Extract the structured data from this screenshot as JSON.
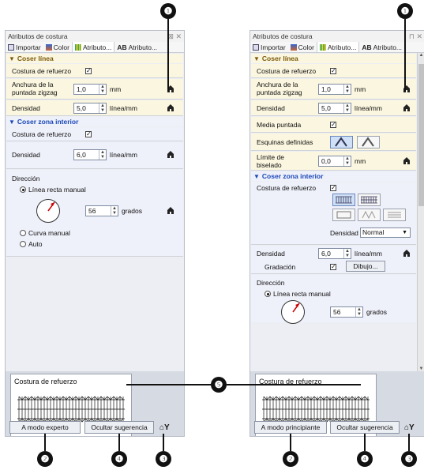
{
  "callouts": {
    "n1": "❶",
    "n2": "❷",
    "n3": "❸",
    "n4": "❹",
    "n5": "❺"
  },
  "left": {
    "title": "Atributos de costura",
    "tabs": [
      "Importar",
      "Color",
      "Atributo...",
      "Atributo..."
    ],
    "sections": {
      "coser_linea": "Coser línea",
      "coser_zona": "Coser zona interior"
    },
    "rows": {
      "refuerzo1": "Costura de refuerzo",
      "anchura": "Anchura de la puntada zigzag",
      "anchura_val": "1,0",
      "anchura_unit": "mm",
      "densidad1": "Densidad",
      "densidad1_val": "5,0",
      "densidad1_unit": "línea/mm",
      "refuerzo2": "Costura de refuerzo",
      "densidad2": "Densidad",
      "densidad2_val": "6,0",
      "densidad2_unit": "línea/mm",
      "direccion": "Dirección",
      "linea_recta": "Línea recta manual",
      "grados_val": "56",
      "grados_unit": "grados",
      "curva": "Curva manual",
      "auto": "Auto"
    },
    "hint_label": "Costura de refuerzo",
    "btn_mode": "A modo experto",
    "btn_hide": "Ocultar sugerencia"
  },
  "right": {
    "title": "Atributos de costura",
    "tabs": [
      "Importar",
      "Color",
      "Atributo...",
      "Atributo..."
    ],
    "sections": {
      "coser_linea": "Coser línea",
      "coser_zona": "Coser zona interior"
    },
    "rows": {
      "refuerzo1": "Costura de refuerzo",
      "anchura": "Anchura de la puntada zigzag",
      "anchura_val": "1,0",
      "anchura_unit": "mm",
      "densidad1": "Densidad",
      "densidad1_val": "5,0",
      "densidad1_unit": "línea/mm",
      "media": "Media puntada",
      "esquinas": "Esquinas definidas",
      "limite": "Límite de biselado",
      "limite_val": "0,0",
      "limite_unit": "mm",
      "refuerzo2": "Costura de refuerzo",
      "densidad_sel_label": "Densidad",
      "densidad_sel": "Normal",
      "densidad2": "Densidad",
      "densidad2_val": "6,0",
      "densidad2_unit": "línea/mm",
      "gradacion": "Gradación",
      "dibujo": "Dibujo...",
      "direccion": "Dirección",
      "linea_recta": "Línea recta manual",
      "grados_val": "56",
      "grados_unit": "grados"
    },
    "hint_label": "Costura de refuerzo",
    "btn_mode": "A modo principiante",
    "btn_hide": "Ocultar sugerencia"
  },
  "colors": {
    "yellow_section": "#fbf6df",
    "blue_section": "#eef0fa",
    "callout": "#111111",
    "needle": "#cc0000"
  }
}
